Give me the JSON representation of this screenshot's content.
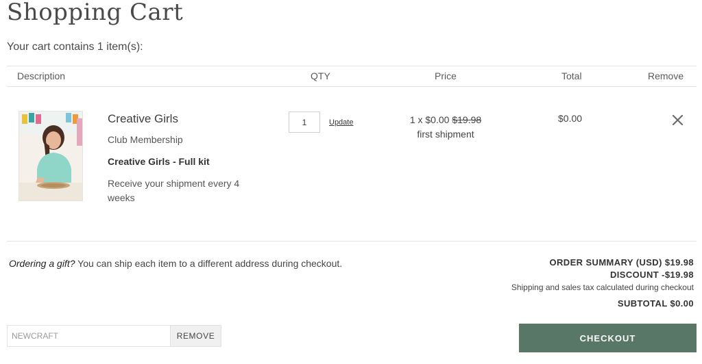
{
  "page": {
    "title": "Shopping Cart",
    "cart_count_text": "Your cart contains 1 item(s):"
  },
  "table": {
    "headers": {
      "description": "Description",
      "qty": "QTY",
      "price": "Price",
      "total": "Total",
      "remove": "Remove"
    }
  },
  "item": {
    "name": "Creative Girls",
    "type": "Club Membership",
    "kit": "Creative Girls - Full kit",
    "frequency": "Receive your shipment every 4 weeks",
    "qty": "1",
    "update_label": "Update",
    "price_prefix": "1 x $0.00",
    "price_original": "$19.98",
    "price_note": "first shipment",
    "total": "$0.00",
    "remove_icon": "close-icon"
  },
  "gift": {
    "lead": "Ordering a gift?",
    "text": " You can ship each item to a different address during checkout."
  },
  "summary": {
    "order_summary": "ORDER SUMMARY (USD) $19.98",
    "discount": "DISCOUNT -$19.98",
    "shipping_note": "Shipping and sales tax calculated during checkout",
    "subtotal": "SUBTOTAL $0.00"
  },
  "promo": {
    "code_value": "NEWCRAFT",
    "remove_label": "REMOVE"
  },
  "checkout": {
    "label": "CHECKOUT"
  },
  "colors": {
    "checkout_bg": "#587767",
    "divider": "#e2e2e2"
  }
}
